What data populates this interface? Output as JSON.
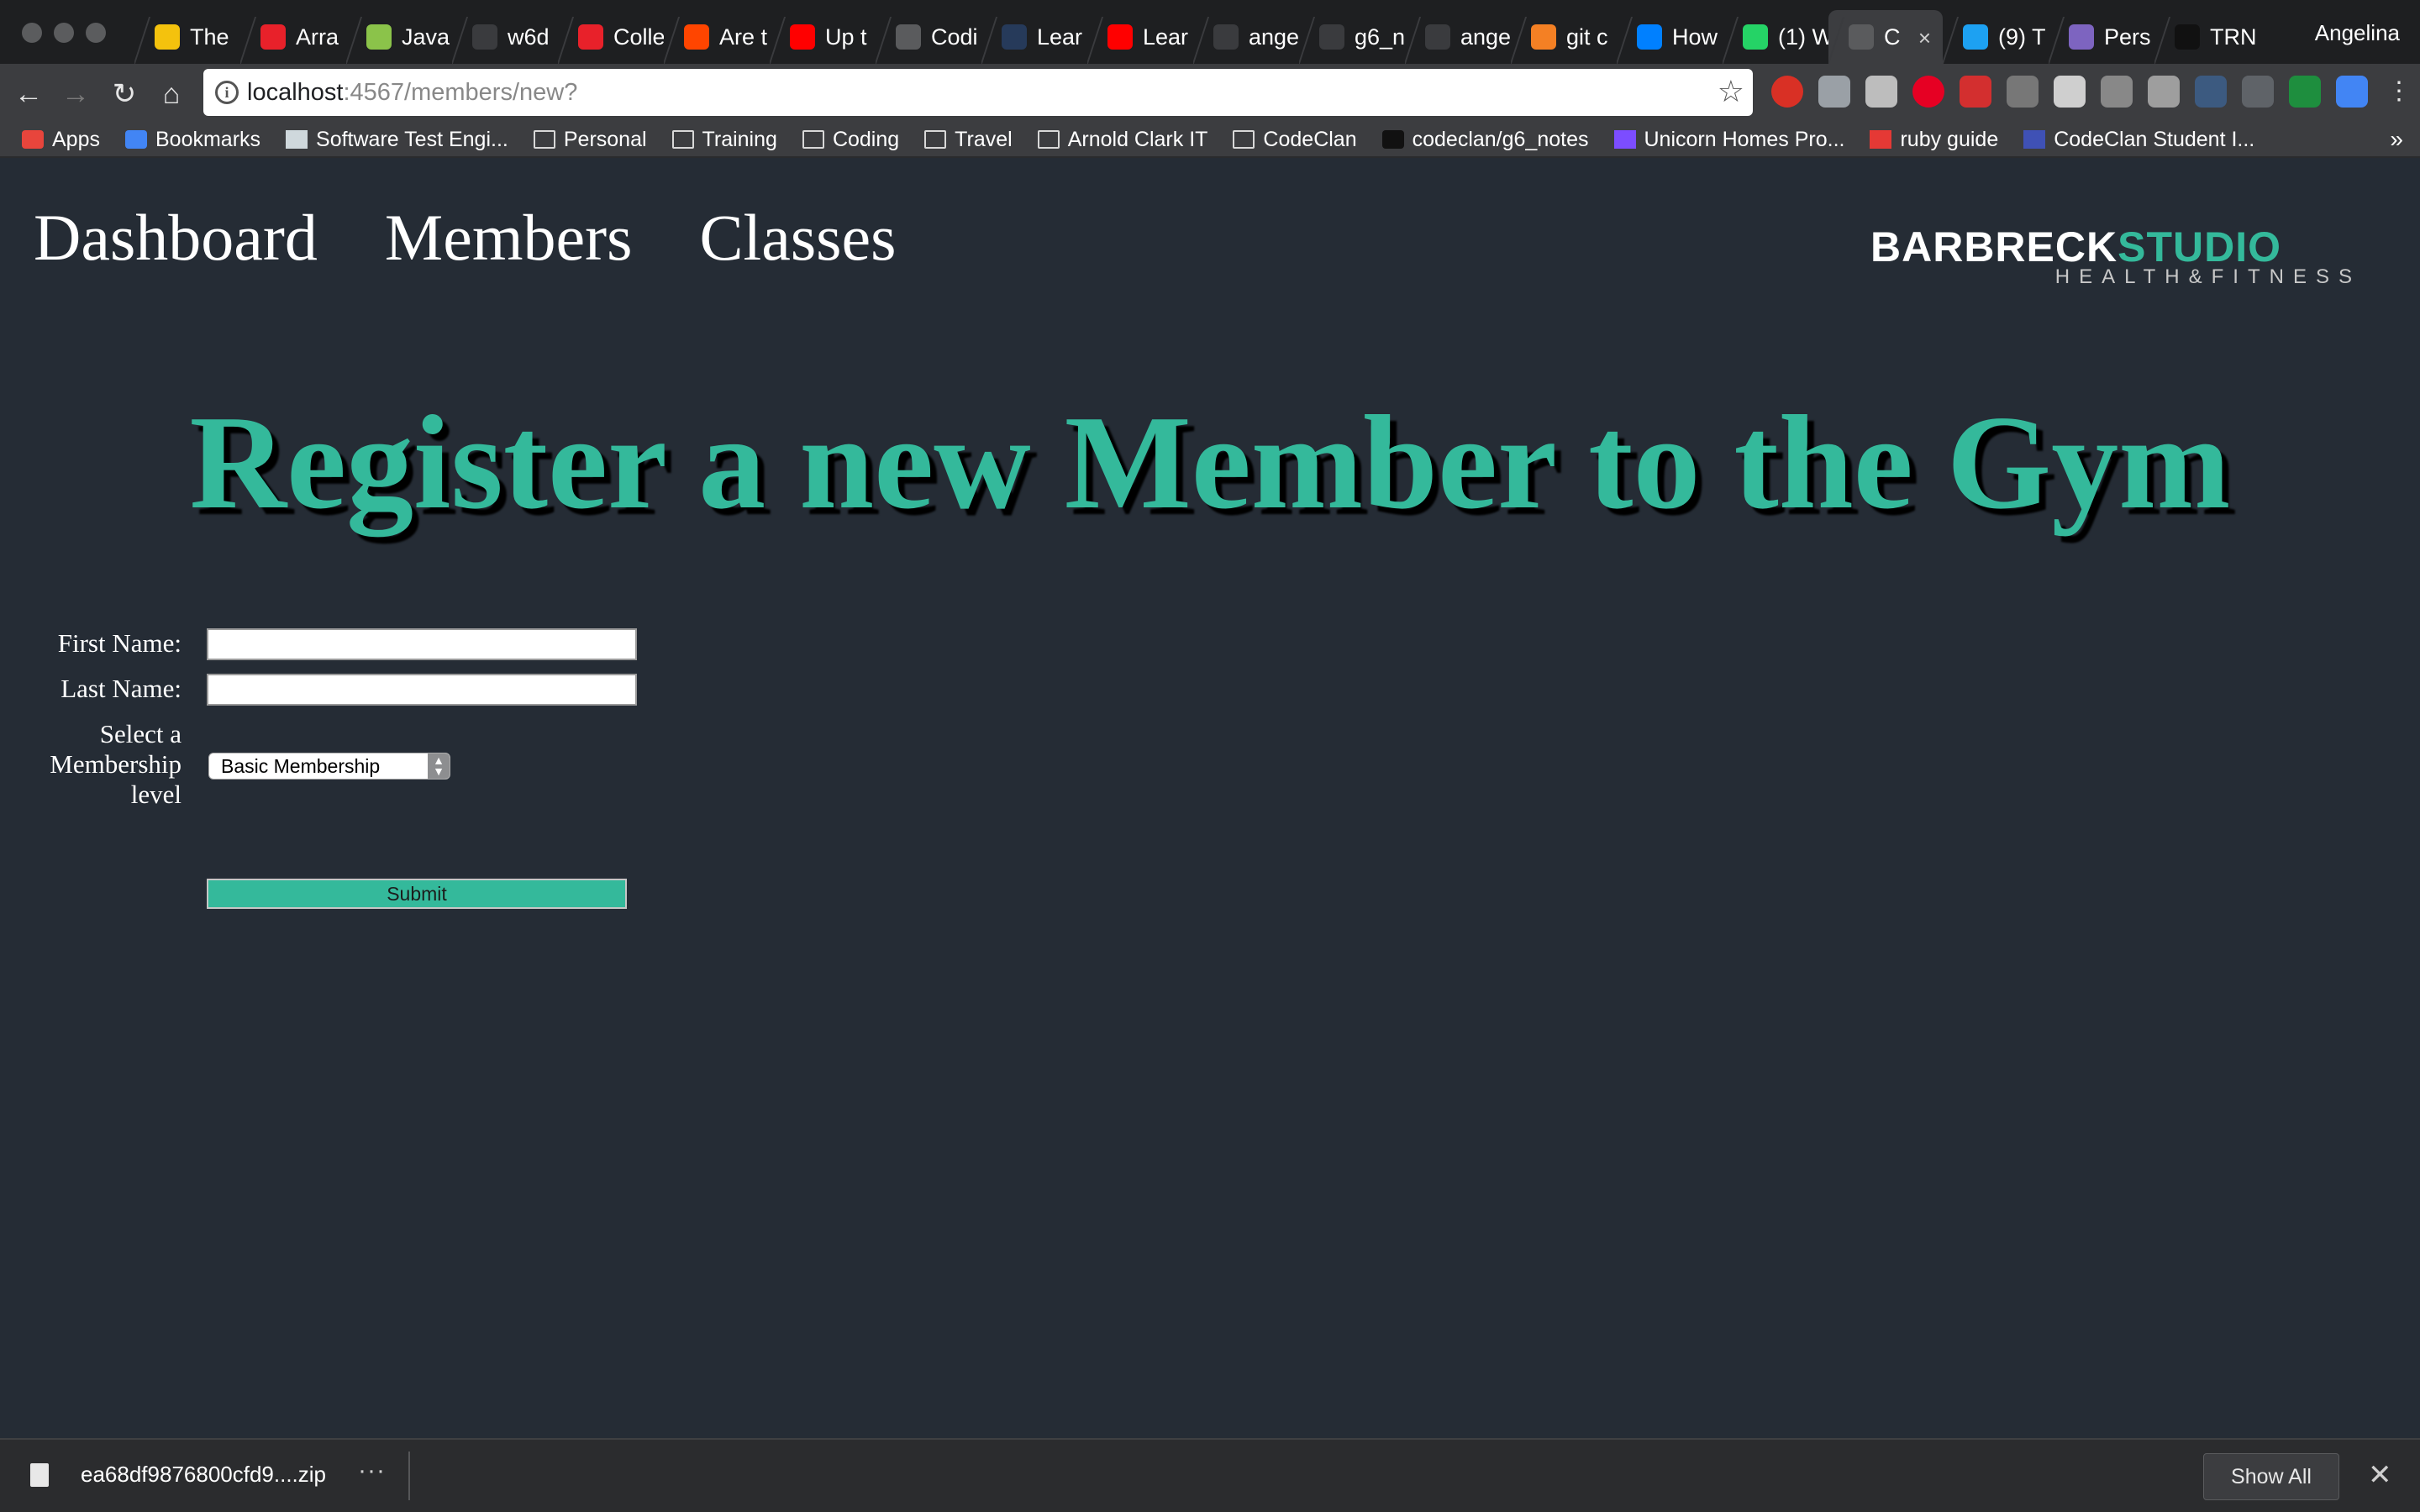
{
  "browser": {
    "tabs": [
      {
        "title": "The",
        "icon": "chrome-icon",
        "color": "#f4c20d"
      },
      {
        "title": "Arra",
        "icon": "oracle-icon",
        "color": "#e8212a"
      },
      {
        "title": "Java",
        "icon": "bars-icon",
        "color": "#8bc34a"
      },
      {
        "title": "w6d",
        "icon": "github-icon",
        "color": "#3a3b3e"
      },
      {
        "title": "Colle",
        "icon": "oracle-icon",
        "color": "#e8212a"
      },
      {
        "title": "Are t",
        "icon": "reddit-icon",
        "color": "#ff4500"
      },
      {
        "title": "Up t",
        "icon": "youtube-icon",
        "color": "#ff0000"
      },
      {
        "title": "Codi",
        "icon": "page-icon",
        "color": "#5a5b5d"
      },
      {
        "title": "Lear",
        "icon": "learn-icon",
        "color": "#263a5a"
      },
      {
        "title": "Lear",
        "icon": "youtube-icon",
        "color": "#ff0000"
      },
      {
        "title": "ange",
        "icon": "github-icon",
        "color": "#3a3b3e"
      },
      {
        "title": "g6_n",
        "icon": "github-icon",
        "color": "#3a3b3e"
      },
      {
        "title": "ange",
        "icon": "github-icon",
        "color": "#3a3b3e"
      },
      {
        "title": "git c",
        "icon": "stackoverflow-icon",
        "color": "#f48024"
      },
      {
        "title": "How",
        "icon": "digitalocean-icon",
        "color": "#0080ff"
      },
      {
        "title": "(1) W",
        "icon": "whatsapp-icon",
        "color": "#25d366"
      },
      {
        "title": "C",
        "icon": "page-icon",
        "color": "#5a5b5d",
        "active": true
      },
      {
        "title": "(9) T",
        "icon": "twitter-icon",
        "color": "#1da1f2"
      },
      {
        "title": "Pers",
        "icon": "heroku-icon",
        "color": "#7d64c0"
      },
      {
        "title": "TRN",
        "icon": "trn-icon",
        "color": "#111111"
      }
    ],
    "profile_name": "Angelina",
    "url_host": "localhost",
    "url_path": ":4567/members/new?",
    "bookmarks": [
      {
        "label": "Apps",
        "icon": "apps-grid-icon"
      },
      {
        "label": "Bookmarks",
        "icon": "star-icon"
      },
      {
        "label": "Software Test Engi...",
        "icon": "page-icon"
      },
      {
        "label": "Personal",
        "icon": "folder-icon"
      },
      {
        "label": "Training",
        "icon": "folder-icon"
      },
      {
        "label": "Coding",
        "icon": "folder-icon"
      },
      {
        "label": "Travel",
        "icon": "folder-icon"
      },
      {
        "label": "Arnold Clark IT",
        "icon": "folder-icon"
      },
      {
        "label": "CodeClan",
        "icon": "folder-icon"
      },
      {
        "label": "codeclan/g6_notes",
        "icon": "github-icon"
      },
      {
        "label": "Unicorn Homes Pro...",
        "icon": "unicorn-icon"
      },
      {
        "label": "ruby guide",
        "icon": "ruby-icon"
      },
      {
        "label": "CodeClan Student I...",
        "icon": "codeclan-icon"
      }
    ]
  },
  "page": {
    "nav": [
      "Dashboard",
      "Members",
      "Classes"
    ],
    "logo": {
      "bar": "BARBRECK",
      "studio": "STUDIO",
      "sub": "HEALTH&FITNESS"
    },
    "headline": "Register a new Member to the Gym",
    "form": {
      "first_name_label": "First Name:",
      "first_name_value": "",
      "last_name_label": "Last Name:",
      "last_name_value": "",
      "membership_label": [
        "Select a",
        "Membership",
        "level"
      ],
      "membership_selected": "Basic Membership",
      "submit_label": "Submit"
    }
  },
  "downloads": {
    "file_name": "ea68df9876800cfd9....zip",
    "show_all_label": "Show All"
  },
  "colors": {
    "page_bg": "#252c35",
    "accent": "#34b99b"
  }
}
